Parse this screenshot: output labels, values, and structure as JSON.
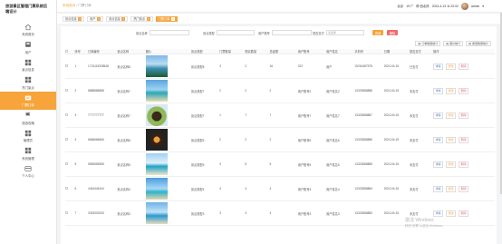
{
  "brand": {
    "line1": "旅游景区管理门票系统后",
    "line2": "端设计"
  },
  "sidebar": {
    "items": [
      {
        "label": "系统首页",
        "icon": "home-icon"
      },
      {
        "label": "用户",
        "icon": "user-icon"
      },
      {
        "label": "景点信息",
        "icon": "grid-icon"
      },
      {
        "label": "热门景点",
        "icon": "grid-icon"
      },
      {
        "label": "门票订单",
        "icon": "ticket-icon",
        "active": true
      },
      {
        "label": "旅游攻略",
        "icon": "flag-icon"
      },
      {
        "label": "管理员",
        "icon": "grid-icon"
      },
      {
        "label": "系统管理",
        "icon": "grid-icon"
      },
      {
        "label": "个人中心",
        "icon": "card-icon"
      }
    ]
  },
  "header": {
    "crumb_home": "系统首页",
    "crumb_sep": "/",
    "crumb_current": "门票订单",
    "location": "北京",
    "temp": "19.7°",
    "wind": "晴 西北风",
    "date": "2024-4-13 11:22:02",
    "user": "admin"
  },
  "tabs": [
    {
      "label": "景点信息",
      "active": false
    },
    {
      "label": "用户",
      "active": false
    },
    {
      "label": "景点信息",
      "active": false
    },
    {
      "label": "热门景点",
      "active": false
    },
    {
      "label": "门票订单",
      "active": true
    }
  ],
  "filters": {
    "f1": "景点名称",
    "f2": "景点类型",
    "f3": "用户账号",
    "f4": "是否支付",
    "f4_value": "请选择",
    "search": "查询",
    "delete": "删除"
  },
  "toolbar": {
    "b1": "订单数量统计",
    "b2": "票价统计",
    "b3": "类型数量统计"
  },
  "table": {
    "headers": [
      "",
      "序号",
      "订单编号",
      "景点名称",
      "图片",
      "景点类型",
      "门票数量",
      "购买数量",
      "总金额",
      "用户账号",
      "用户姓名",
      "手机号",
      "日期",
      "是否支付",
      "操作"
    ],
    "rows": [
      [
        "1",
        "1713115328548",
        "景点名称8",
        "景点类型8",
        "3",
        "2",
        "16",
        "222",
        "用户",
        "15216487575",
        "2024-04-15",
        "已支付"
      ],
      [
        "2",
        "8888888888",
        "景点名称7",
        "景点类型7",
        "2",
        "2",
        "2",
        "用户账号2",
        "用户姓名2",
        "13323888888",
        "2024-04-15",
        "未支付"
      ],
      [
        "3",
        "7777777777",
        "景点名称7",
        "景点类型7",
        "1",
        "7",
        "7",
        "用户账号7",
        "用户姓名7",
        "13323888887",
        "2024-04-15",
        "未支付"
      ],
      [
        "4",
        "6666666666",
        "景点名称6",
        "景点类型6",
        "2",
        "2",
        "2",
        "用户账号6",
        "用户姓名6",
        "13323888886",
        "2024-04-15",
        "未支付"
      ],
      [
        "5",
        "5555555555",
        "景点名称5",
        "景点类型5",
        "3",
        "5",
        "5",
        "用户账号5",
        "用户姓名5",
        "13323888885",
        "2024-04-15",
        "未支付"
      ],
      [
        "6",
        "4444444444",
        "景点名称4",
        "景点类型4",
        "4",
        "4",
        "4",
        "用户账号4",
        "用户姓名4",
        "13323888884",
        "2024-04-15",
        "未支付"
      ],
      [
        "7",
        "3333333333",
        "景点名称3",
        "景点类型3",
        "3",
        "3",
        "3",
        "用户账号3",
        "用户姓名3",
        "13323888883",
        "2024-04-15",
        "未支付"
      ]
    ],
    "actions": {
      "view": "详情",
      "edit": "修改",
      "del": "删除"
    }
  },
  "watermark": {
    "title": "激活 Windows",
    "sub": "转到“设置”以激活 Windows。"
  },
  "colors": {
    "accent": "#f7a43a",
    "danger": "#f26b6b",
    "link": "#3a7bd5"
  }
}
